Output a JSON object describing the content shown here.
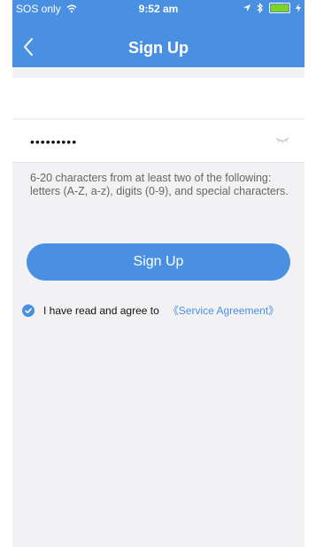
{
  "status_bar": {
    "carrier": "SOS only",
    "time": "9:52 am"
  },
  "nav": {
    "title": "Sign Up"
  },
  "form": {
    "account_input_value": "",
    "password_dots": "•••••••••",
    "hint": "6-20 characters from at least two of the following: letters (A-Z, a-z), digits (0-9), and special characters."
  },
  "actions": {
    "sign_up_label": "Sign Up"
  },
  "agreement": {
    "text": "I have read and agree to",
    "link": "《Service Agreement》",
    "checked": true
  },
  "colors": {
    "brand_blue": "#4a90e2",
    "background": "#f2f2f4",
    "battery_green": "#7ed321"
  },
  "icons": [
    "wifi-icon",
    "location-arrow-icon",
    "bluetooth-icon",
    "battery-icon",
    "charging-icon",
    "back-chevron-icon",
    "eye-closed-icon",
    "check-circle-icon"
  ]
}
